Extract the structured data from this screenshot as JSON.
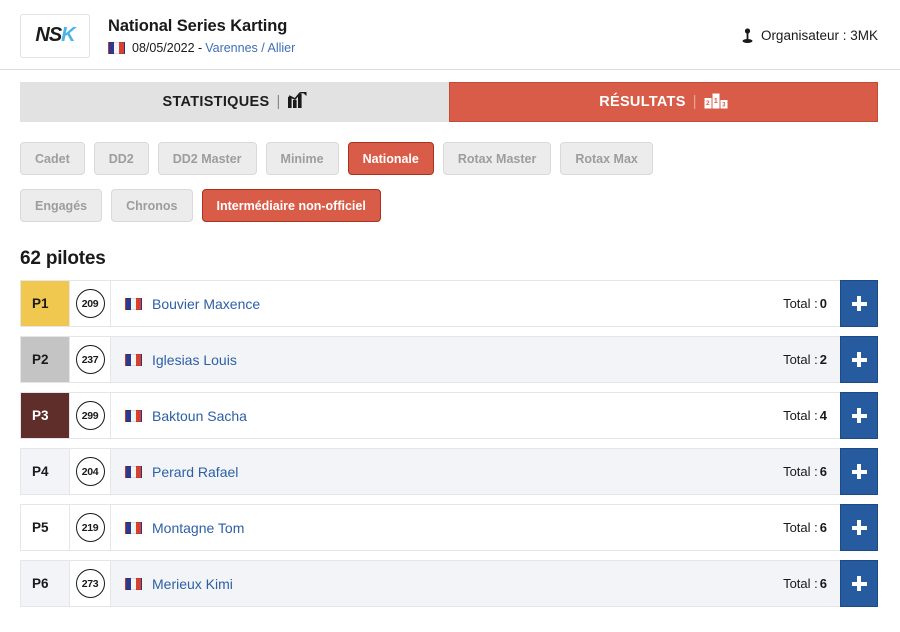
{
  "header": {
    "logo_text_dark": "NS",
    "logo_text_accent": "K",
    "title": "National Series Karting",
    "date": "08/05/2022 -",
    "location": "Varennes / Allier",
    "organiser_label": "Organisateur : 3MK",
    "organiser_icon": "person-pin-icon",
    "flag_icon": "flag-france-icon"
  },
  "main_tabs": [
    {
      "label": "STATISTIQUES",
      "icon": "bar-chart-icon",
      "active": false
    },
    {
      "label": "RÉSULTATS",
      "icon": "podium-icon",
      "active": true
    }
  ],
  "category_filters": [
    {
      "label": "Cadet",
      "active": false
    },
    {
      "label": "DD2",
      "active": false
    },
    {
      "label": "DD2 Master",
      "active": false
    },
    {
      "label": "Minime",
      "active": false
    },
    {
      "label": "Nationale",
      "active": true
    },
    {
      "label": "Rotax Master",
      "active": false
    },
    {
      "label": "Rotax Max",
      "active": false
    }
  ],
  "session_filters": [
    {
      "label": "Engagés",
      "active": false
    },
    {
      "label": "Chronos",
      "active": false
    },
    {
      "label": "Intermédiaire non-officiel",
      "active": true
    }
  ],
  "results": {
    "count_heading": "62 pilotes",
    "total_label": "Total :",
    "add_button_icon": "plus-icon",
    "rows": [
      {
        "position": "P1",
        "number": "209",
        "name": "Bouvier Maxence",
        "total": "0",
        "medal": "gold",
        "striped": false
      },
      {
        "position": "P2",
        "number": "237",
        "name": "Iglesias Louis",
        "total": "2",
        "medal": "silver",
        "striped": true
      },
      {
        "position": "P3",
        "number": "299",
        "name": "Baktoun Sacha",
        "total": "4",
        "medal": "bronze",
        "striped": false
      },
      {
        "position": "P4",
        "number": "204",
        "name": "Perard Rafael",
        "total": "6",
        "medal": "plain",
        "striped": true
      },
      {
        "position": "P5",
        "number": "219",
        "name": "Montagne Tom",
        "total": "6",
        "medal": "plain",
        "striped": false
      },
      {
        "position": "P6",
        "number": "273",
        "name": "Merieux Kimi",
        "total": "6",
        "medal": "plain",
        "striped": true
      }
    ]
  },
  "colors": {
    "accent_red": "#d85c47",
    "link_blue": "#2d5fa5",
    "add_blue": "#275ba0",
    "gold": "#f0c84f",
    "silver": "#c4c4c4",
    "bronze": "#5f2d2a"
  }
}
